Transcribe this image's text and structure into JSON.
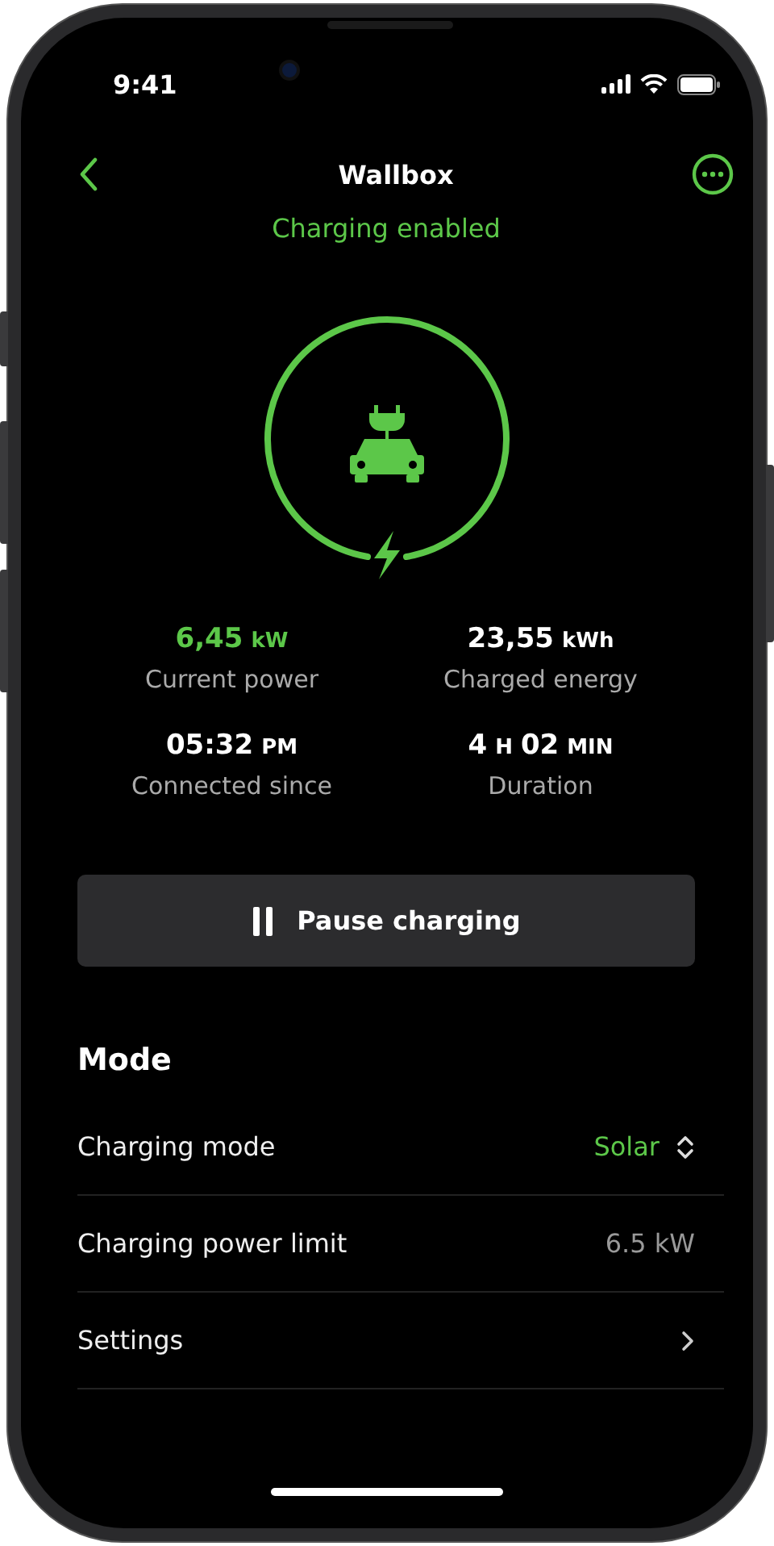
{
  "status_bar": {
    "time": "9:41"
  },
  "nav": {
    "title": "Wallbox"
  },
  "status": "Charging enabled",
  "stats": [
    {
      "parts": [
        {
          "kind": "num",
          "text": "6,45"
        },
        {
          "kind": "unit",
          "text": "kW"
        }
      ],
      "highlight": true,
      "label": "Current power"
    },
    {
      "parts": [
        {
          "kind": "num",
          "text": "23,55"
        },
        {
          "kind": "unit",
          "text": "kWh"
        }
      ],
      "highlight": false,
      "label": "Charged energy"
    },
    {
      "parts": [
        {
          "kind": "num",
          "text": "05:32"
        },
        {
          "kind": "unit",
          "text": "PM"
        }
      ],
      "highlight": false,
      "label": "Connected since"
    },
    {
      "parts": [
        {
          "kind": "num",
          "text": "4"
        },
        {
          "kind": "unit",
          "text": "H"
        },
        {
          "kind": "num",
          "text": "02"
        },
        {
          "kind": "unit",
          "text": "MIN"
        }
      ],
      "highlight": false,
      "label": "Duration"
    }
  ],
  "pause_button": {
    "label": "Pause charging"
  },
  "section": {
    "title": "Mode",
    "rows": [
      {
        "kind": "select",
        "label": "Charging mode",
        "value": "Solar"
      },
      {
        "kind": "value",
        "label": "Charging power limit",
        "value": "6.5 kW"
      },
      {
        "kind": "link",
        "label": "Settings"
      }
    ]
  }
}
